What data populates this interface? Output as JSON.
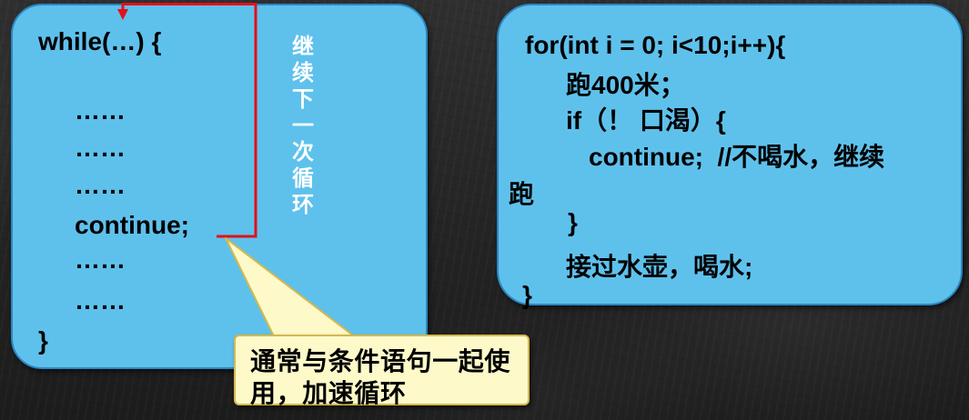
{
  "left_panel": {
    "lines": [
      "while(…) {",
      "……",
      "……",
      "……",
      "continue;",
      "……",
      "……",
      "}"
    ]
  },
  "loop_label": "继续下一次循环",
  "callout": {
    "lines": [
      "通常与条件语句一起使",
      "用，加速循环"
    ]
  },
  "right_panel": {
    "lines": [
      "for(int i = 0; i<10;i++){",
      "跑400米；",
      "if（！ 口渴）{",
      "continue;  //不喝水，继续",
      "跑",
      "}",
      "接过水壶，喝水;",
      "}"
    ]
  },
  "colors": {
    "panel_fill": "#5ec1ec",
    "panel_border": "#2e86c1",
    "arrow": "#e3101b",
    "callout_fill": "#fdf9c9",
    "callout_border": "#d4b84e",
    "background": "#262626",
    "label_text": "#ffffff",
    "code_text": "#000000"
  }
}
